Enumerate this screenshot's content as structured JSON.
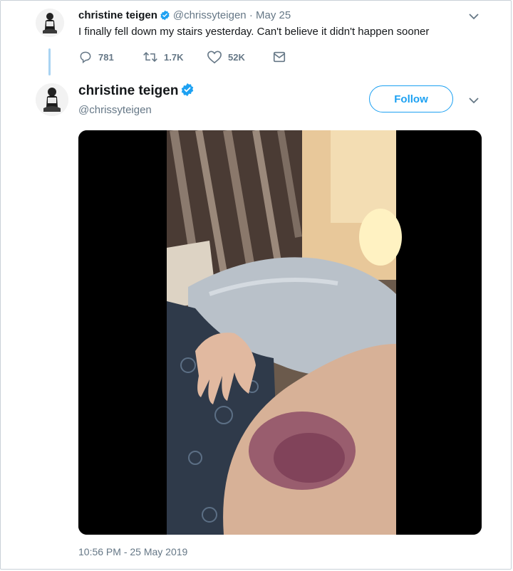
{
  "parent_tweet": {
    "name": "christine teigen",
    "handle": "@chrissyteigen",
    "separator": "·",
    "date": "May 25",
    "text": "I finally fell down my stairs yesterday. Can't believe it didn't happen sooner",
    "replies": "781",
    "retweets": "1.7K",
    "likes": "52K"
  },
  "main_tweet": {
    "name": "christine teigen",
    "handle": "@chrissyteigen",
    "follow_label": "Follow",
    "timestamp": "10:56 PM - 25 May 2019"
  },
  "icons": {
    "verified": "verified-badge-icon",
    "reply": "reply-icon",
    "retweet": "retweet-icon",
    "like": "heart-icon",
    "dm": "envelope-icon",
    "more": "chevron-down-icon"
  },
  "colors": {
    "accent": "#1da1f2",
    "secondary_text": "#657786",
    "primary_text": "#14171a",
    "thread_line": "#a9d3f2"
  }
}
